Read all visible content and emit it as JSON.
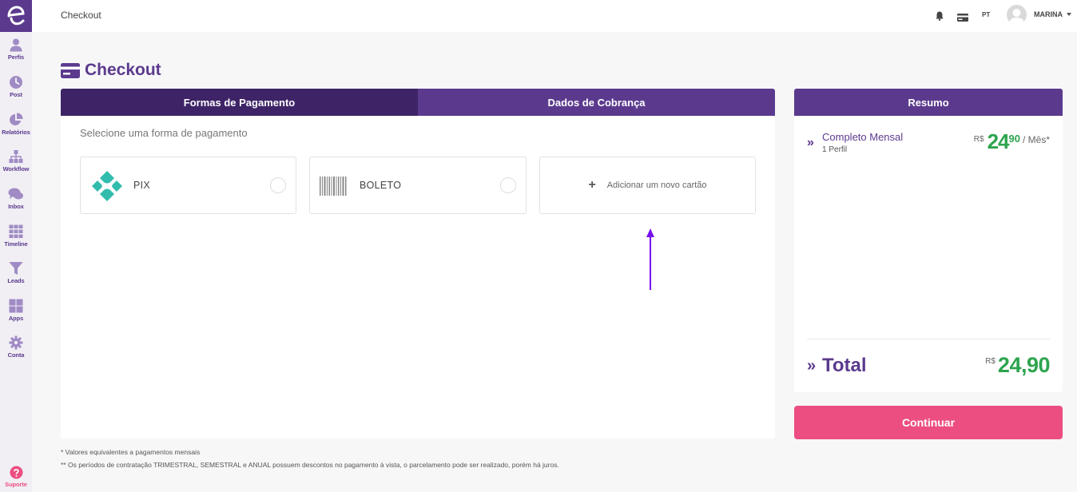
{
  "sidebar": {
    "items": [
      {
        "label": "Perfis",
        "icon": "person-icon"
      },
      {
        "label": "Post",
        "icon": "clock-icon"
      },
      {
        "label": "Relatórios",
        "icon": "pie-chart-icon"
      },
      {
        "label": "Workflow",
        "icon": "workflow-icon"
      },
      {
        "label": "Inbox",
        "icon": "chat-icon"
      },
      {
        "label": "Timeline",
        "icon": "grid-icon"
      },
      {
        "label": "Leads",
        "icon": "filter-icon"
      },
      {
        "label": "Apps",
        "icon": "apps-icon"
      },
      {
        "label": "Conta",
        "icon": "gear-icon"
      }
    ],
    "support": "Suporte"
  },
  "topbar": {
    "title": "Checkout",
    "lang": "PT",
    "username": "MARINA"
  },
  "page": {
    "heading": "Checkout"
  },
  "tabs": [
    "Formas de Pagamento",
    "Dados de Cobrança"
  ],
  "payment": {
    "subtitle": "Selecione uma forma de pagamento",
    "pix": "PIX",
    "boleto": "BOLETO",
    "add_card": "Adicionar um novo cartão",
    "add_plus": "+"
  },
  "summary": {
    "title": "Resumo",
    "chevron": "»",
    "plan_name": "Completo Mensal",
    "plan_sub": "1 Perfil",
    "currency": "R$",
    "price_int": "24",
    "price_dec": ",90",
    "price_dec_display": "90",
    "per": "/ Mês*",
    "total_label": "Total",
    "total_amount": "24,90"
  },
  "continue_label": "Continuar",
  "footnotes": [
    "* Valores equivalentes a pagamentos mensais",
    "** Os períodos de contratação TRIMESTRAL, SEMESTRAL e ANUAL possuem descontos no pagamento à vista, o parcelamento pode ser realizado, porém há juros."
  ],
  "colors": {
    "brand": "#5b3a8e",
    "brand_dark": "#3e2467",
    "accent_pink": "#ec4e81",
    "price_green": "#2ea44f",
    "pix_teal": "#32bcad",
    "arrow": "#7711ee"
  }
}
